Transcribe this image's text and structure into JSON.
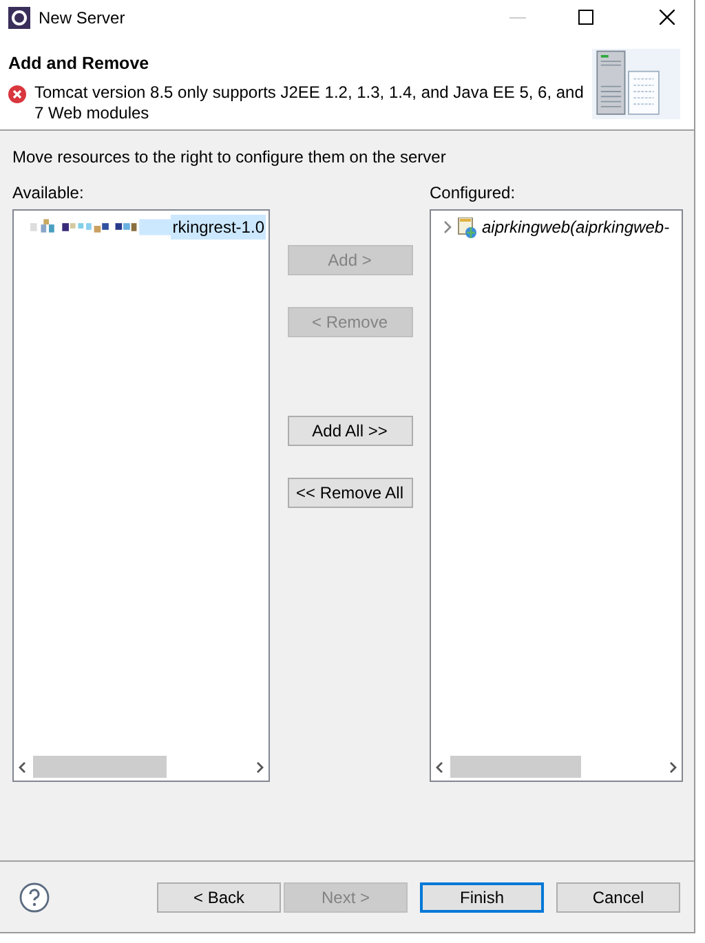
{
  "window": {
    "title": "New Server"
  },
  "header": {
    "title": "Add and Remove",
    "error": "Tomcat version 8.5 only supports J2EE 1.2, 1.3, 1.4, and Java EE 5, 6, and 7 Web modules"
  },
  "instruction": "Move resources to the right to configure them on the server",
  "available": {
    "label": "Available:",
    "items": [
      {
        "label": "rkingrest-1.0",
        "selected": true
      }
    ]
  },
  "configured": {
    "label": "Configured:",
    "items": [
      {
        "label": "aiprkingweb(aiprkingweb-",
        "selected": false,
        "expanded": false
      }
    ]
  },
  "move_buttons": [
    {
      "label": "Add >",
      "disabled": true
    },
    {
      "label": "< Remove",
      "disabled": true
    },
    {
      "label": "Add All >>",
      "disabled": false
    },
    {
      "label": "<< Remove All",
      "disabled": false
    }
  ],
  "footer_buttons": [
    {
      "label": "< Back",
      "disabled": false,
      "default": false
    },
    {
      "label": "Next >",
      "disabled": true,
      "default": false
    },
    {
      "label": "Finish",
      "disabled": false,
      "default": true
    },
    {
      "label": "Cancel",
      "disabled": false,
      "default": false
    }
  ]
}
